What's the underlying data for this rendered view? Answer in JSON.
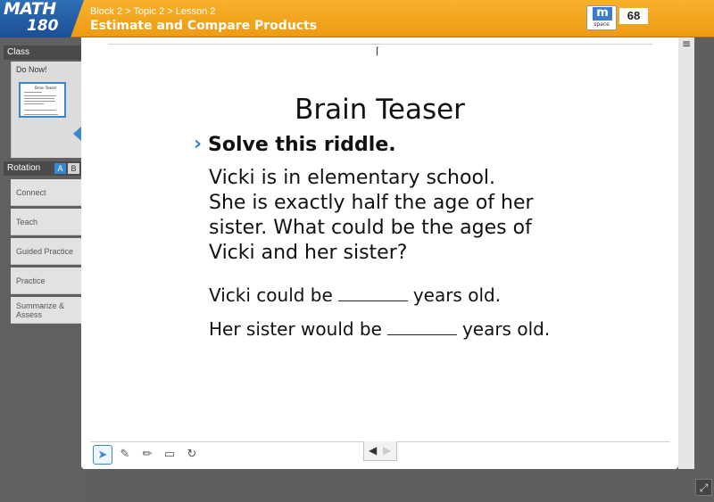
{
  "header": {
    "logo": {
      "line1": "MATH",
      "line2": "180"
    },
    "breadcrumb": "Block 2 > Topic 2 > Lesson 2",
    "title": "Estimate and Compare Products",
    "mspace_label": "m",
    "mspace_sub": "space",
    "points": "68"
  },
  "sidebar": {
    "class_label": "Class",
    "donow_label": "Do Now!",
    "rotation_label": "Rotation",
    "rotation_a": "A",
    "rotation_b": "B",
    "items": [
      {
        "label": "Connect"
      },
      {
        "label": "Teach"
      },
      {
        "label": "Guided Practice"
      },
      {
        "label": "Practice"
      },
      {
        "label": "Summarize & Assess"
      }
    ]
  },
  "slide": {
    "title": "Brain Teaser",
    "heading": "Solve this riddle.",
    "riddle_lines": [
      "Vicki is in elementary school.",
      "She is exactly half the age of her",
      "sister. What could be the ages of",
      "Vicki and her sister?"
    ],
    "answer1_pre": "Vicki could be",
    "answer1_post": "years old.",
    "answer2_pre": "Her sister would be",
    "answer2_post": "years old."
  },
  "toolbar": {
    "tools": [
      "pointer-icon",
      "marker-icon",
      "pencil-icon",
      "eraser-icon",
      "reset-icon"
    ]
  },
  "colors": {
    "header": "#f2a21c",
    "accent": "#3a87d0",
    "logo": "#235ba3"
  }
}
